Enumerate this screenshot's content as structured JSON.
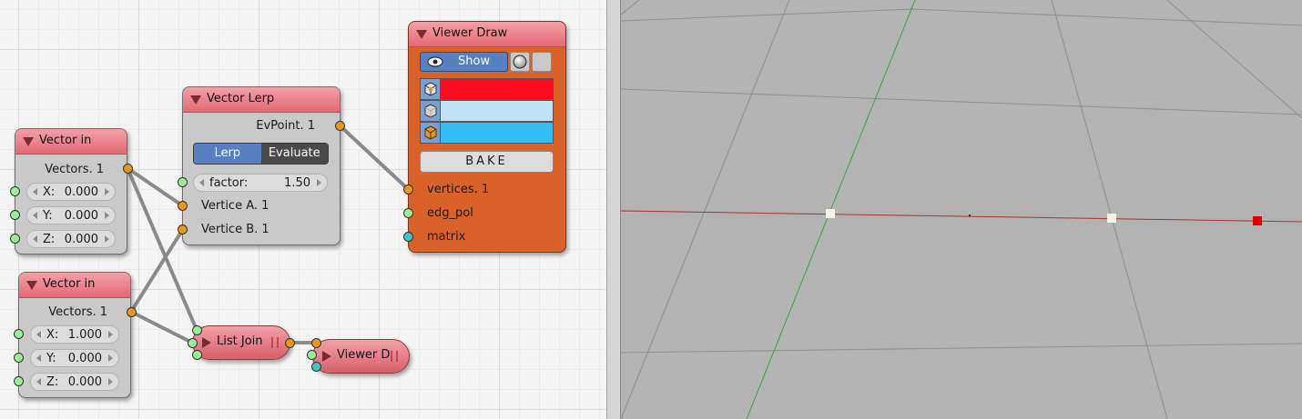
{
  "nodes": {
    "vector_in_1": {
      "title": "Vector in",
      "output_label": "Vectors. 1",
      "x": {
        "label": "X:",
        "value": "0.000"
      },
      "y": {
        "label": "Y:",
        "value": "0.000"
      },
      "z": {
        "label": "Z:",
        "value": "0.000"
      }
    },
    "vector_in_2": {
      "title": "Vector in",
      "output_label": "Vectors. 1",
      "x": {
        "label": "X:",
        "value": "1.000"
      },
      "y": {
        "label": "Y:",
        "value": "0.000"
      },
      "z": {
        "label": "Z:",
        "value": "0.000"
      }
    },
    "vector_lerp": {
      "title": "Vector Lerp",
      "output_label": "EvPoint. 1",
      "mode_lerp": "Lerp",
      "mode_evaluate": "Evaluate",
      "factor": {
        "label": "factor:",
        "value": "1.50"
      },
      "input_a": "Vertice A. 1",
      "input_b": "Vertice B. 1"
    },
    "list_join": {
      "title": "List Join"
    },
    "viewer_d": {
      "title": "Viewer D"
    },
    "viewer_draw": {
      "title": "Viewer Draw",
      "show_label": "Show",
      "colors": {
        "vertex": "#ff0a1e",
        "edge": "#bfe3f5",
        "face": "#33bdf2"
      },
      "bake_label": "BAKE",
      "input_vertices": "vertices. 1",
      "input_edg_pol": "edg_pol",
      "input_matrix": "matrix"
    }
  },
  "colors": {
    "node_header": "#e26a76",
    "node_body": "#c9c9c9",
    "viewer_body": "#d8622a",
    "socket_vector": "#e8961e",
    "socket_float": "#9aee9a",
    "socket_matrix": "#40c4c8",
    "toggle_on": "#5680c2"
  },
  "icons": {
    "collapse": "triangle-down-icon",
    "eye": "eye-icon",
    "sphere": "sphere-icon",
    "cube": "cube-icon"
  }
}
